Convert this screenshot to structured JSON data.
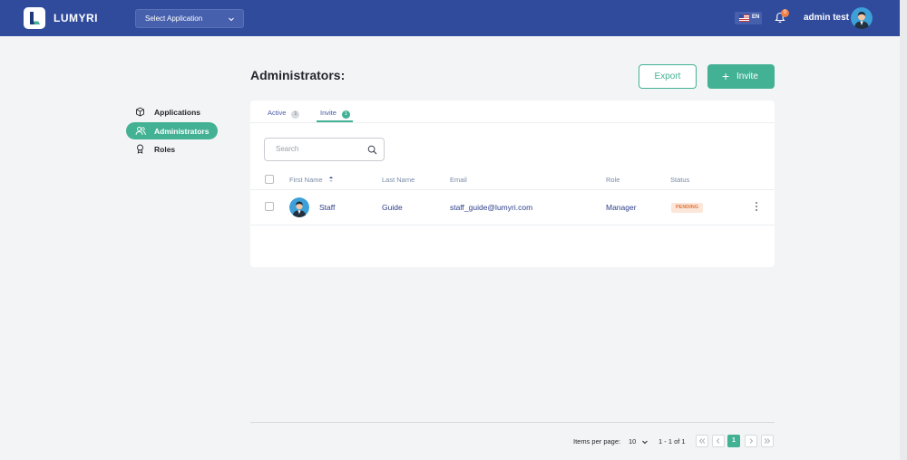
{
  "header": {
    "logo_text": "LUMYRI",
    "app_select": {
      "label": "Select Application"
    },
    "language": "EN",
    "notifications_count": "0",
    "user_name": "admin test"
  },
  "sidebar": {
    "items": [
      {
        "label": "Applications",
        "icon": "box-icon",
        "active": false
      },
      {
        "label": "Administrators",
        "icon": "users-icon",
        "active": true
      },
      {
        "label": "Roles",
        "icon": "award-icon",
        "active": false
      }
    ]
  },
  "page": {
    "title": "Administrators:",
    "export_label": "Export",
    "invite_label": "Invite"
  },
  "tabs": [
    {
      "label": "Active",
      "count": "1",
      "active": false
    },
    {
      "label": "Invite",
      "count": "1",
      "active": true
    }
  ],
  "search": {
    "placeholder": "Search"
  },
  "table": {
    "columns": [
      "First Name",
      "Last Name",
      "Email",
      "Role",
      "Status"
    ],
    "rows": [
      {
        "first_name": "Staff",
        "last_name": "Guide",
        "email": "staff_guide@lumyri.com",
        "role": "Manager",
        "status": "PENDING"
      }
    ]
  },
  "pagination": {
    "items_per_page_label": "Items per page:",
    "items_per_page": "10",
    "range": "1 - 1 of 1",
    "current_page": "1"
  },
  "colors": {
    "topbar": "#304b9c",
    "accent": "#43b194",
    "pending_bg": "#fbe6d9",
    "pending_text": "#e0753c"
  }
}
